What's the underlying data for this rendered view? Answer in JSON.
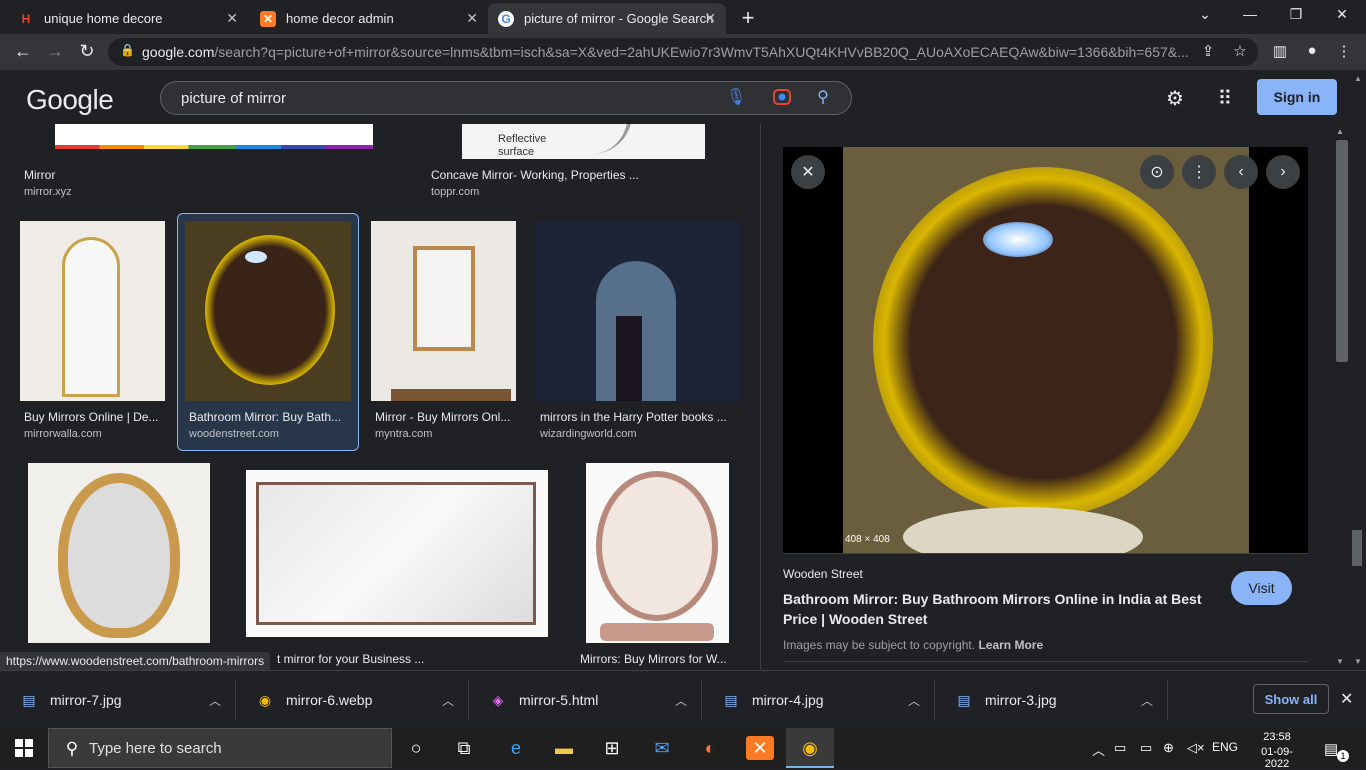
{
  "tabs": [
    {
      "title": "unique home decore",
      "icon": "h-logo-icon"
    },
    {
      "title": "home decor admin",
      "icon": "xampp-icon"
    },
    {
      "title": "picture of mirror - Google Search",
      "icon": "google-icon"
    }
  ],
  "url": {
    "domain": "google.com",
    "rest": "/search?q=picture+of+mirror&source=lnms&tbm=isch&sa=X&ved=2ahUKEwio7r3WmvT5AhXUQt4KHVvBB20Q_AUoAXoECAEQAw&biw=1366&bih=657&..."
  },
  "google": {
    "logo": "Google",
    "query": "picture of mirror",
    "signin": "Sign in"
  },
  "results": {
    "row0": [
      {
        "caption": "Mirror",
        "source": "mirror.xyz"
      },
      {
        "caption": "Concave Mirror- Working, Properties ...",
        "source": "toppr.com",
        "img_text": "Reflective surface"
      }
    ],
    "row1": [
      {
        "caption": "Buy Mirrors Online | De...",
        "source": "mirrorwalla.com"
      },
      {
        "caption": "Bathroom Mirror: Buy Bath...",
        "source": "woodenstreet.com"
      },
      {
        "caption": "Mirror - Buy Mirrors Onl...",
        "source": "myntra.com"
      },
      {
        "caption": "mirrors in the Harry Potter books ...",
        "source": "wizardingworld.com"
      }
    ],
    "row2": [
      {
        "caption": ""
      },
      {
        "caption": "t mirror for your Business ..."
      },
      {
        "caption": "Mirrors: Buy Mirrors for W..."
      }
    ]
  },
  "status_url": "https://www.woodenstreet.com/bathroom-mirrors",
  "panel": {
    "dimensions": "408 × 408",
    "site": "Wooden Street",
    "title": "Bathroom Mirror: Buy Bathroom Mirrors Online in India at Best Price | Wooden Street",
    "copyright": "Images may be subject to copyright.",
    "learn_more": "Learn More",
    "visit": "Visit"
  },
  "downloads": [
    {
      "name": "mirror-7.jpg",
      "icon": "file-icon"
    },
    {
      "name": "mirror-6.webp",
      "icon": "chrome-icon"
    },
    {
      "name": "mirror-5.html",
      "icon": "html-icon"
    },
    {
      "name": "mirror-4.jpg",
      "icon": "file-icon"
    },
    {
      "name": "mirror-3.jpg",
      "icon": "file-icon"
    }
  ],
  "show_all": "Show all",
  "taskbar": {
    "search_placeholder": "Type here to search",
    "lang": "ENG",
    "time": "23:58",
    "date": "01-09-2022",
    "notif_count": "1"
  }
}
